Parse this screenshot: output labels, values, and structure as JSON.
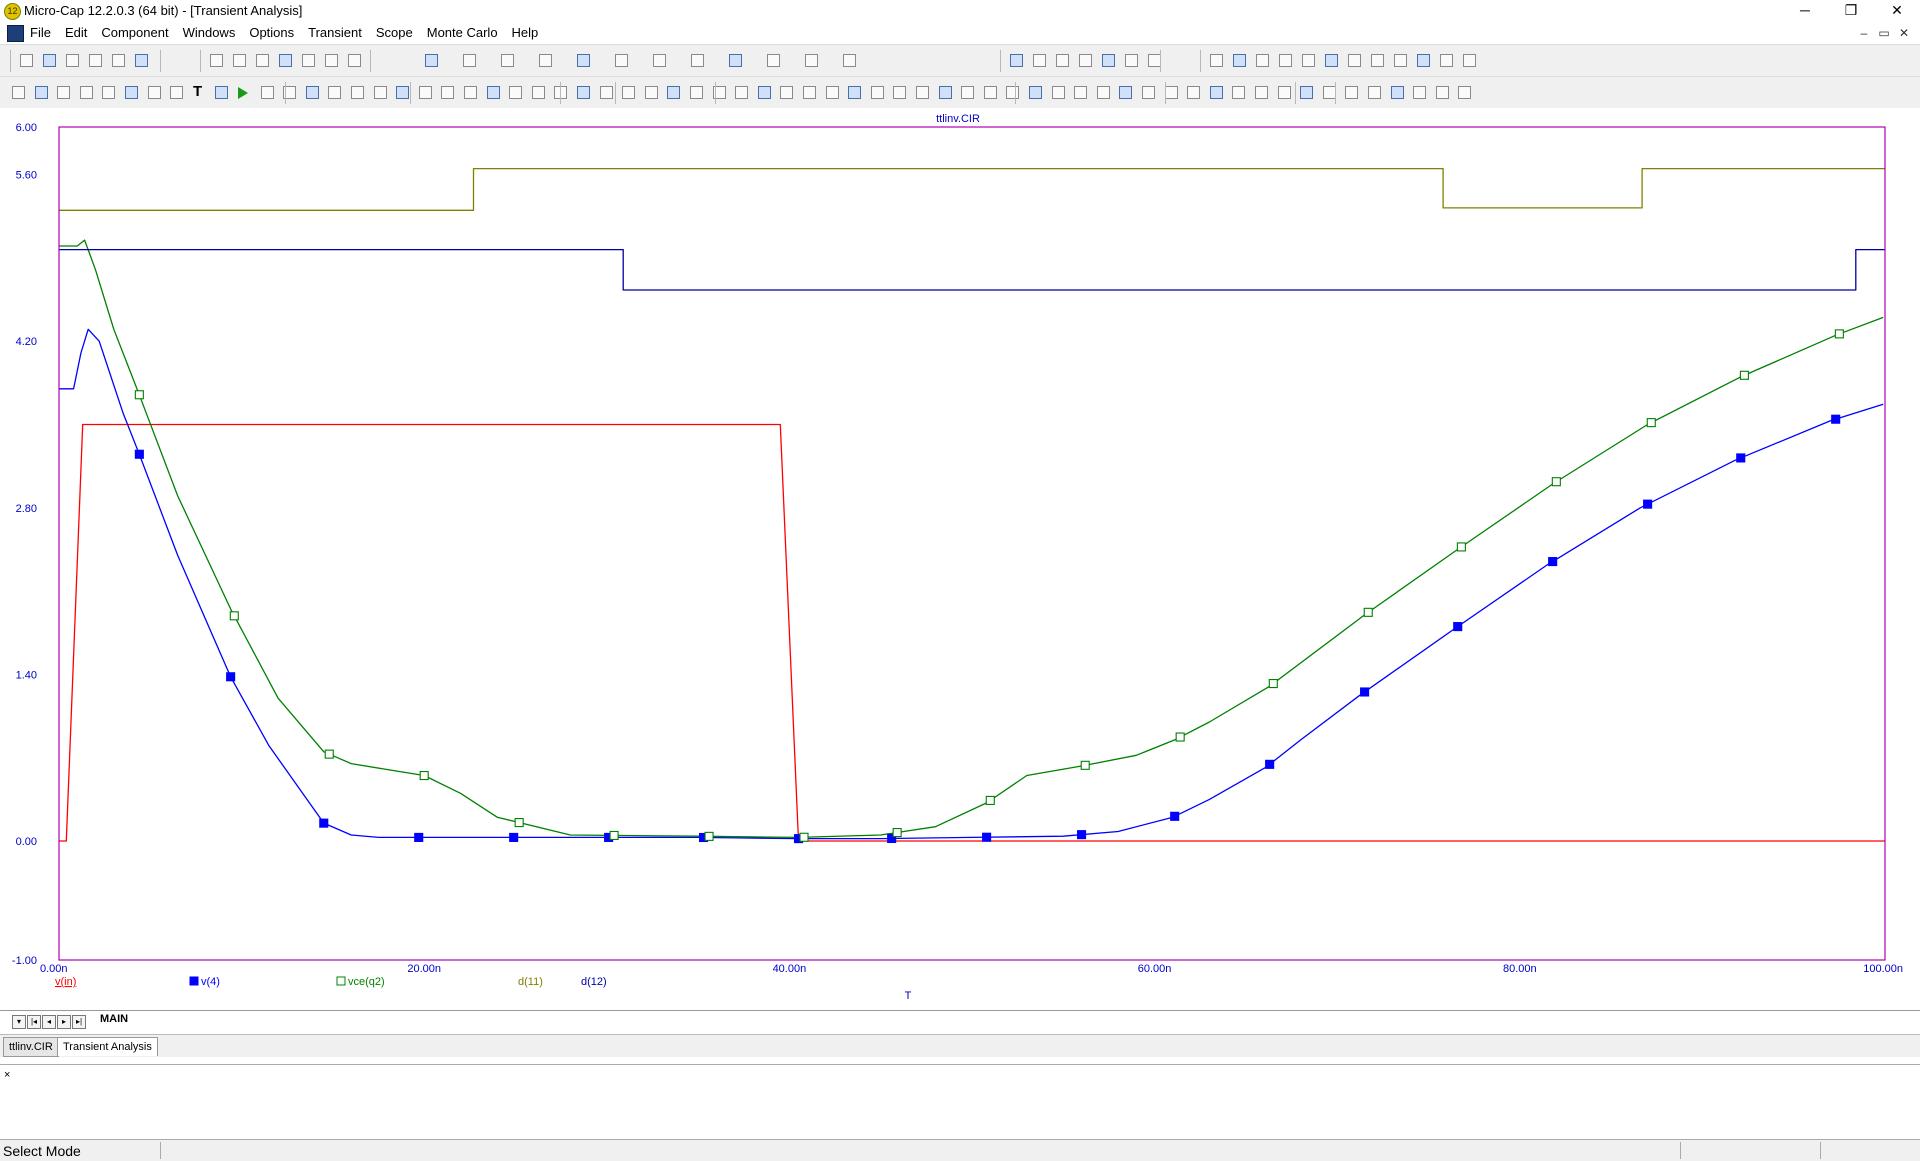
{
  "window": {
    "title": "Micro-Cap 12.2.0.3 (64 bit) - [Transient Analysis]",
    "app_icon": "12",
    "controls": {
      "minimize": "─",
      "restore": "❐",
      "close": "✕"
    },
    "mdi_controls": {
      "minimize": "–",
      "restore": "▭",
      "close": "✕"
    }
  },
  "menu": {
    "items": [
      "File",
      "Edit",
      "Component",
      "Windows",
      "Options",
      "Transient",
      "Scope",
      "Monte Carlo",
      "Help"
    ]
  },
  "plot": {
    "title": "ttlinv.CIR",
    "xlabel": "T",
    "colors": {
      "frame": "#b000b0",
      "axis_labels": "#0000c8",
      "vin": "#ff0000",
      "v4": "#0000ff",
      "vce": "#008000",
      "d11": "#808000",
      "d12": "#0000a0"
    }
  },
  "chart_data": {
    "type": "line",
    "title": "ttlinv.CIR",
    "xlabel": "T",
    "ylabel": "",
    "xlim": [
      0,
      100
    ],
    "ylim": [
      -1,
      6
    ],
    "x_ticks": [
      {
        "v": 0,
        "label": "0.00n"
      },
      {
        "v": 20,
        "label": "20.00n"
      },
      {
        "v": 40,
        "label": "40.00n"
      },
      {
        "v": 60,
        "label": "60.00n"
      },
      {
        "v": 80,
        "label": "80.00n"
      },
      {
        "v": 100,
        "label": "100.00n"
      }
    ],
    "y_ticks": [
      {
        "v": 6,
        "label": "6.00"
      },
      {
        "v": 5.6,
        "label": "5.60"
      },
      {
        "v": 4.2,
        "label": "4.20"
      },
      {
        "v": 2.8,
        "label": "2.80"
      },
      {
        "v": 1.4,
        "label": "1.40"
      },
      {
        "v": 0,
        "label": "0.00"
      },
      {
        "v": -1,
        "label": "-1.00"
      }
    ],
    "grid": false,
    "legend": "bottom",
    "series": [
      {
        "name": "v(in)",
        "color": "#ff0000",
        "marker": "none",
        "x": [
          0,
          0.4,
          1.3,
          39.5,
          40.5,
          100
        ],
        "y": [
          0,
          0,
          3.5,
          3.5,
          0,
          0
        ]
      },
      {
        "name": "v(4)",
        "color": "#0000ff",
        "marker": "filled",
        "x": [
          0,
          0.4,
          0.8,
          1.2,
          1.6,
          2.2,
          3.5,
          4.4,
          6.5,
          9.4,
          11.5,
          14.5,
          16,
          17.5,
          20,
          25,
          30,
          35,
          40.5,
          45,
          50,
          55,
          58,
          61,
          63,
          66.1,
          68,
          71.2,
          76.3,
          81.5,
          86.6,
          91.8,
          97,
          99.9
        ],
        "y": [
          3.8,
          3.8,
          3.8,
          4.1,
          4.3,
          4.2,
          3.6,
          3.25,
          2.4,
          1.38,
          0.8,
          0.15,
          0.05,
          0.03,
          0.03,
          0.03,
          0.03,
          0.03,
          0.02,
          0.02,
          0.03,
          0.04,
          0.08,
          0.2,
          0.35,
          0.62,
          0.85,
          1.22,
          1.77,
          2.32,
          2.8,
          3.2,
          3.53,
          3.67
        ],
        "markers": [
          4.4,
          9.4,
          14.5,
          19.7,
          24.9,
          30.1,
          35.3,
          40.5,
          45.6,
          50.8,
          56,
          61.1,
          66.3,
          71.5,
          76.6,
          81.8,
          87,
          92.1,
          97.3
        ]
      },
      {
        "name": "vce(q2)",
        "color": "#008000",
        "marker": "open",
        "x": [
          0,
          0.5,
          1,
          1.4,
          2,
          3,
          4.4,
          6.5,
          9.4,
          12,
          14.5,
          16,
          18,
          20,
          22,
          24,
          28,
          35,
          40.5,
          45,
          48,
          50.8,
          53,
          56,
          59,
          61.1,
          63,
          66.3,
          71.5,
          76.6,
          81.8,
          87,
          92.1,
          97.3,
          99.9
        ],
        "y": [
          5.0,
          5.0,
          5.0,
          5.05,
          4.8,
          4.3,
          3.75,
          2.9,
          1.95,
          1.2,
          0.75,
          0.65,
          0.6,
          0.55,
          0.4,
          0.2,
          0.05,
          0.04,
          0.03,
          0.05,
          0.12,
          0.32,
          0.55,
          0.63,
          0.72,
          0.85,
          1.0,
          1.3,
          1.9,
          2.45,
          3.0,
          3.5,
          3.9,
          4.25,
          4.4
        ],
        "markers": [
          4.4,
          9.6,
          14.8,
          20,
          25.2,
          30.4,
          35.6,
          40.8,
          45.9,
          51,
          56.2,
          61.4,
          66.5,
          71.7,
          76.8,
          82,
          87.2,
          92.3,
          97.5
        ]
      },
      {
        "name": "d(11)",
        "color": "#808000",
        "marker": "none",
        "x": [
          0,
          22.7,
          22.7,
          75.8,
          75.8,
          86.7,
          86.7,
          100
        ],
        "y": [
          5.3,
          5.3,
          5.65,
          5.65,
          5.32,
          5.32,
          5.65,
          5.65
        ]
      },
      {
        "name": "d(12)",
        "color": "#0000a0",
        "marker": "none",
        "x": [
          0,
          30.9,
          30.9,
          98.4,
          98.4,
          100
        ],
        "y": [
          4.97,
          4.97,
          4.63,
          4.63,
          4.97,
          4.97
        ]
      }
    ]
  },
  "sheet_tabs": {
    "active": "MAIN"
  },
  "file_tabs": [
    "ttlinv.CIR",
    "Transient Analysis"
  ],
  "output_pane": {
    "close_glyph": "×"
  },
  "status": {
    "text": "Select Mode"
  }
}
